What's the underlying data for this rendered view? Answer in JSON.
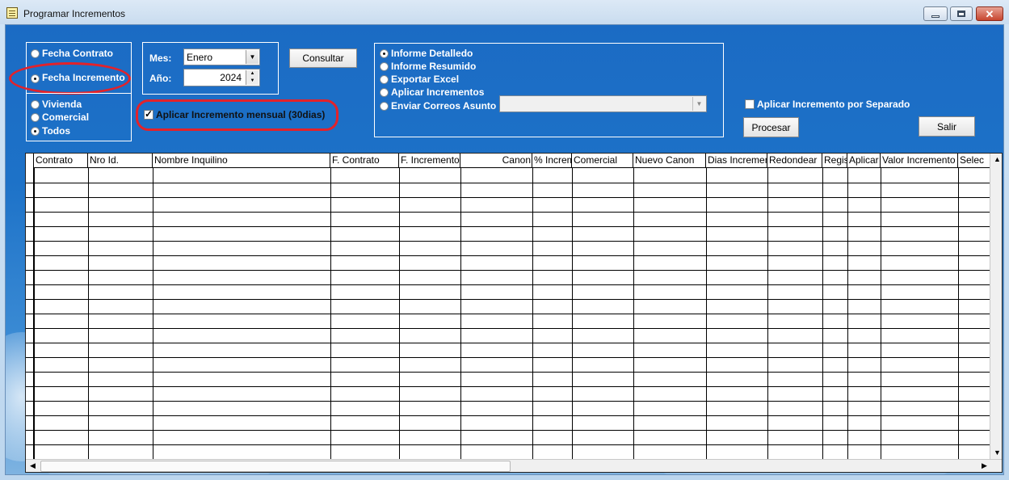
{
  "window": {
    "title": "Programar Incrementos",
    "icon": "document-icon"
  },
  "filter_type": {
    "options": [
      "Fecha Contrato",
      "Fecha Incremento"
    ],
    "selected": "Fecha Incremento"
  },
  "property_type": {
    "options": [
      "Vivienda",
      "Comercial",
      "Todos"
    ],
    "selected": "Todos"
  },
  "period": {
    "mes_label": "Mes:",
    "mes_value": "Enero",
    "anio_label": "Año:",
    "anio_value": "2024"
  },
  "consultar_label": "Consultar",
  "monthly_increment": {
    "label": "Aplicar Incremento mensual (30dias)",
    "checked": true
  },
  "report_options": {
    "options": [
      "Informe Detalledo",
      "Informe Resumido",
      "Exportar Excel",
      "Aplicar Incrementos",
      "Enviar Correos Asunto"
    ],
    "selected": "Informe Detalledo",
    "asunto_value": ""
  },
  "separate_increment": {
    "label": "Aplicar Incremento por Separado",
    "checked": false
  },
  "procesar_label": "Procesar",
  "salir_label": "Salir",
  "grid": {
    "columns": [
      "Contrato",
      "Nro Id.",
      "Nombre Inquilino",
      "F. Contrato",
      "F. Incremento",
      "Canon",
      "% Incremento",
      "Comercial",
      "Nuevo Canon",
      "Dias Incremento",
      "Redondear",
      "Registro",
      "Aplicar",
      "Valor Incremento",
      "Selec"
    ],
    "rows": []
  },
  "colors": {
    "highlight": "#e3222a",
    "background": "#1d72c8"
  }
}
